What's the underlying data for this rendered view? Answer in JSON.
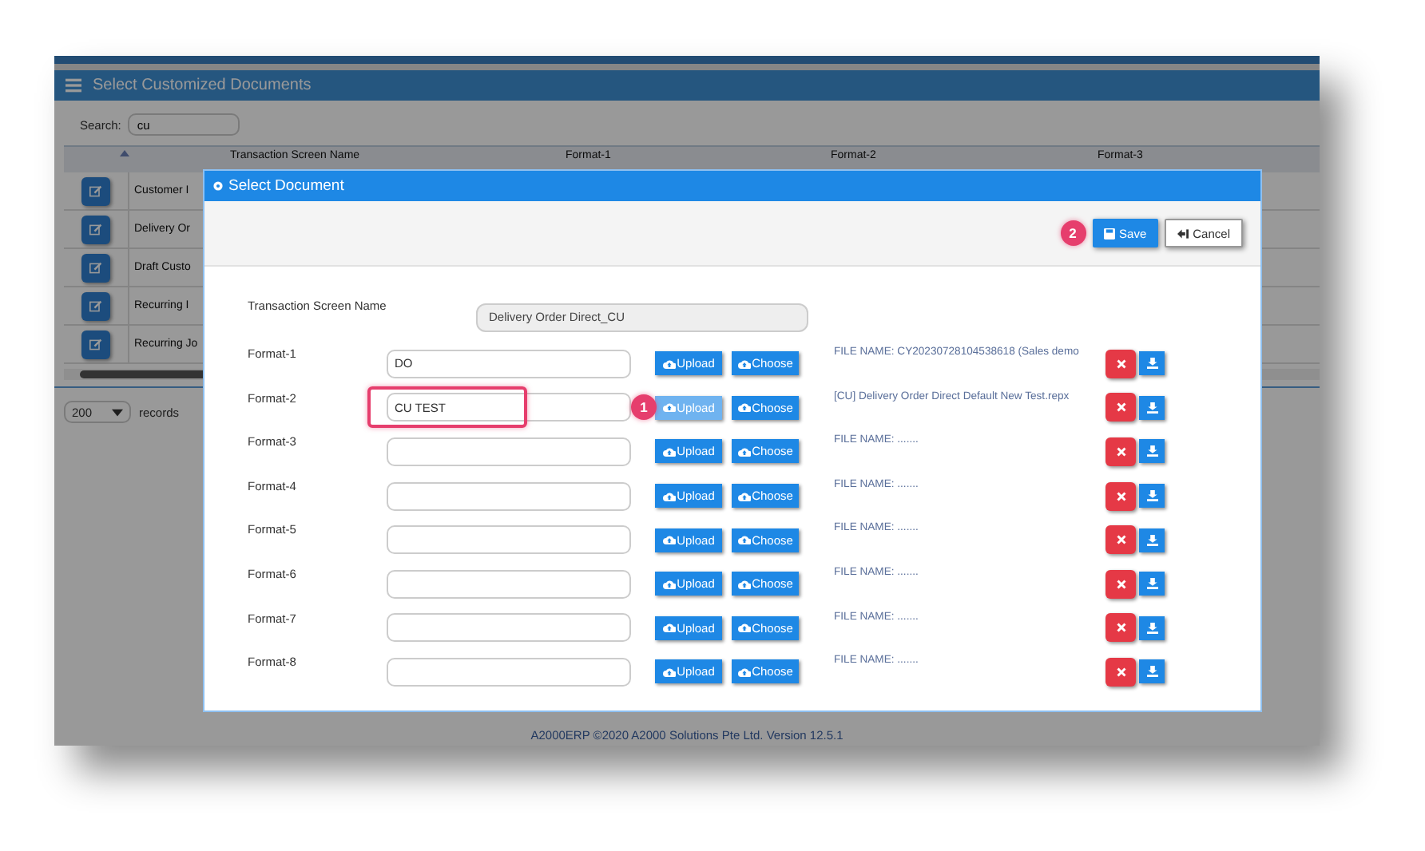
{
  "app": {
    "title": "Select Customized Documents",
    "search": {
      "label": "Search:",
      "value": "cu"
    },
    "table": {
      "columns": [
        "Transaction Screen Name",
        "Format-1",
        "Format-2",
        "Format-3"
      ],
      "rows": [
        {
          "name": "Customer I"
        },
        {
          "name": "Delivery Or"
        },
        {
          "name": "Draft Custo"
        },
        {
          "name": "Recurring I"
        },
        {
          "name": "Recurring Jo"
        }
      ]
    },
    "page_size": "200",
    "records_label": "records",
    "footer": "A2000ERP ©2020 A2000 Solutions Pte Ltd. Version 12.5.1"
  },
  "dialog": {
    "title": "Select Document",
    "save": "Save",
    "cancel": "Cancel",
    "save_callout": "2",
    "screen_label": "Transaction Screen Name",
    "screen_name": "Delivery Order Direct_CU",
    "formats": [
      {
        "label": "Format-1",
        "value": "DO",
        "upload": "Upload",
        "choose": "Choose",
        "file_name": "FILE NAME: CY20230728104538618 (Sales demo",
        "upload_active": false,
        "highlighted": false
      },
      {
        "label": "Format-2",
        "value": "CU TEST",
        "upload": "Upload",
        "choose": "Choose",
        "file_name": "[CU] Delivery Order Direct Default New Test.repx",
        "upload_active": true,
        "highlighted": true,
        "callout": "1"
      },
      {
        "label": "Format-3",
        "upload": "Upload",
        "choose": "Choose",
        "file_name": "FILE NAME: .......",
        "upload_active": false,
        "highlighted": false
      },
      {
        "label": "Format-4",
        "upload": "Upload",
        "choose": "Choose",
        "file_name": "FILE NAME: .......",
        "upload_active": false,
        "highlighted": false
      },
      {
        "label": "Format-5",
        "upload": "Upload",
        "choose": "Choose",
        "file_name": "FILE NAME: .......",
        "upload_active": false,
        "highlighted": false
      },
      {
        "label": "Format-6",
        "upload": "Upload",
        "choose": "Choose",
        "file_name": "FILE NAME: .......",
        "upload_active": false,
        "highlighted": false
      },
      {
        "label": "Format-7",
        "upload": "Upload",
        "choose": "Choose",
        "file_name": "FILE NAME: .......",
        "upload_active": false,
        "highlighted": false
      },
      {
        "label": "Format-8",
        "upload": "Upload",
        "choose": "Choose",
        "file_name": "FILE NAME: .......",
        "upload_active": false,
        "highlighted": false
      }
    ]
  }
}
